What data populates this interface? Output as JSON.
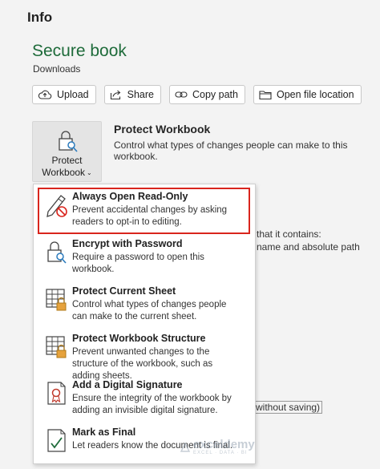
{
  "page": {
    "heading": "Info",
    "doc_title": "Secure book",
    "doc_location": "Downloads"
  },
  "toolbar": {
    "upload": "Upload",
    "share": "Share",
    "copy_path": "Copy path",
    "open_location": "Open file location"
  },
  "protect": {
    "button_line1": "Protect",
    "button_line2": "Workbook",
    "heading": "Protect Workbook",
    "description": "Control what types of changes people can make to this workbook."
  },
  "background_text": {
    "line1": "that it contains:",
    "line2": "name and absolute path",
    "line3": "without saving)"
  },
  "menu": {
    "items": [
      {
        "title": "Always Open Read-Only",
        "description": "Prevent accidental changes by asking readers to opt-in to editing.",
        "icon": "pencil-no-icon"
      },
      {
        "title": "Encrypt with Password",
        "description": "Require a password to open this workbook.",
        "icon": "lock-key-icon"
      },
      {
        "title": "Protect Current Sheet",
        "description": "Control what types of changes people can make to the current sheet.",
        "icon": "sheet-lock-icon"
      },
      {
        "title": "Protect Workbook Structure",
        "description": "Prevent unwanted changes to the structure of the workbook, such as adding sheets.",
        "icon": "workbook-lock-icon"
      },
      {
        "title": "Add a Digital Signature",
        "description": "Ensure the integrity of the workbook by adding an invisible digital signature.",
        "icon": "certificate-icon"
      },
      {
        "title": "Mark as Final",
        "description": "Let readers know the document is final.",
        "icon": "document-check-icon"
      }
    ]
  },
  "watermark": {
    "name": "exceldemy",
    "tagline": "EXCEL · DATA · BI"
  },
  "colors": {
    "accent_green": "#1e6b3a",
    "highlight_red": "#d9251d",
    "lock_gold": "#e6a23c",
    "key_blue": "#2b7bbd"
  }
}
